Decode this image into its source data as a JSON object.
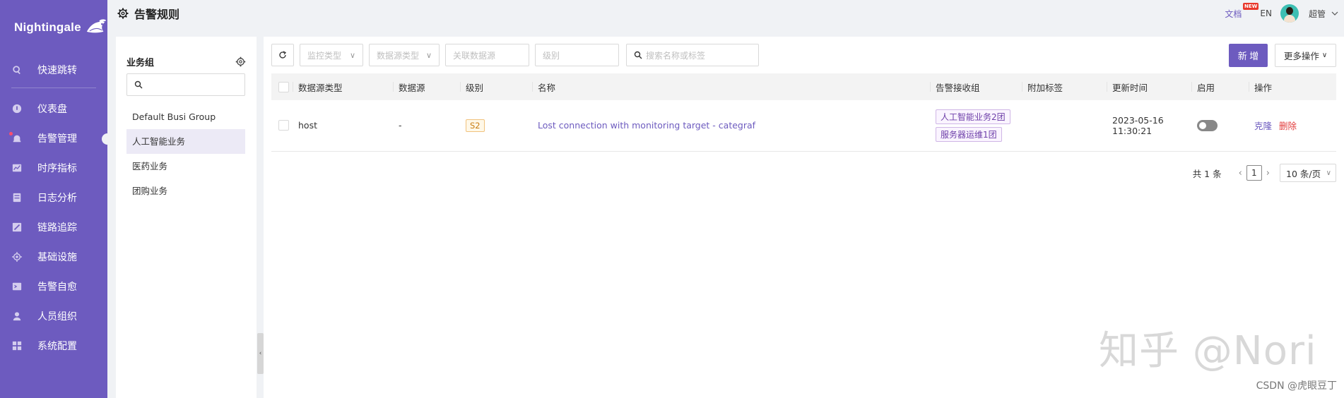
{
  "app": {
    "name": "Nightingale"
  },
  "sidebar": {
    "top_item": {
      "label": "快速跳转",
      "icon": "search-icon"
    },
    "items": [
      {
        "label": "仪表盘",
        "icon": "dashboard-icon"
      },
      {
        "label": "告警管理",
        "icon": "alarm-icon",
        "active": true
      },
      {
        "label": "时序指标",
        "icon": "metrics-icon"
      },
      {
        "label": "日志分析",
        "icon": "log-icon"
      },
      {
        "label": "链路追踪",
        "icon": "trace-icon"
      },
      {
        "label": "基础设施",
        "icon": "infra-icon"
      },
      {
        "label": "告警自愈",
        "icon": "terminal-icon"
      },
      {
        "label": "人员组织",
        "icon": "user-icon"
      },
      {
        "label": "系统配置",
        "icon": "settings-grid-icon"
      }
    ]
  },
  "header": {
    "title": "告警规则",
    "docs": "文档",
    "new_badge": "NEW",
    "lang": "EN",
    "user": "超管"
  },
  "groups": {
    "title": "业务组",
    "search_placeholder": "",
    "items": [
      "Default Busi Group",
      "人工智能业务",
      "医药业务",
      "团购业务"
    ],
    "selected_index": 1
  },
  "toolbar": {
    "filters": [
      "监控类型",
      "数据源类型",
      "关联数据源",
      "级别"
    ],
    "search_placeholder": "搜索名称或标签",
    "add_label": "新 增",
    "more_label": "更多操作"
  },
  "table": {
    "columns": [
      "数据源类型",
      "数据源",
      "级别",
      "名称",
      "告警接收组",
      "附加标签",
      "更新时间",
      "启用",
      "操作"
    ],
    "rows": [
      {
        "ds_type": "host",
        "ds": "-",
        "level": "S2",
        "name": "Lost connection with monitoring target - categraf",
        "groups": [
          "人工智能业务2团",
          "服务器运维1团"
        ],
        "tags": "",
        "updated_date": "2023-05-16",
        "updated_time": "11:30:21",
        "enabled": false,
        "actions": {
          "clone": "克隆",
          "delete": "删除"
        }
      }
    ]
  },
  "pagination": {
    "total": "共 1 条",
    "page": "1",
    "page_size": "10 条/页"
  },
  "watermark": {
    "text": "知乎 @Nori",
    "csdn": "CSDN @虎眼豆丁"
  }
}
